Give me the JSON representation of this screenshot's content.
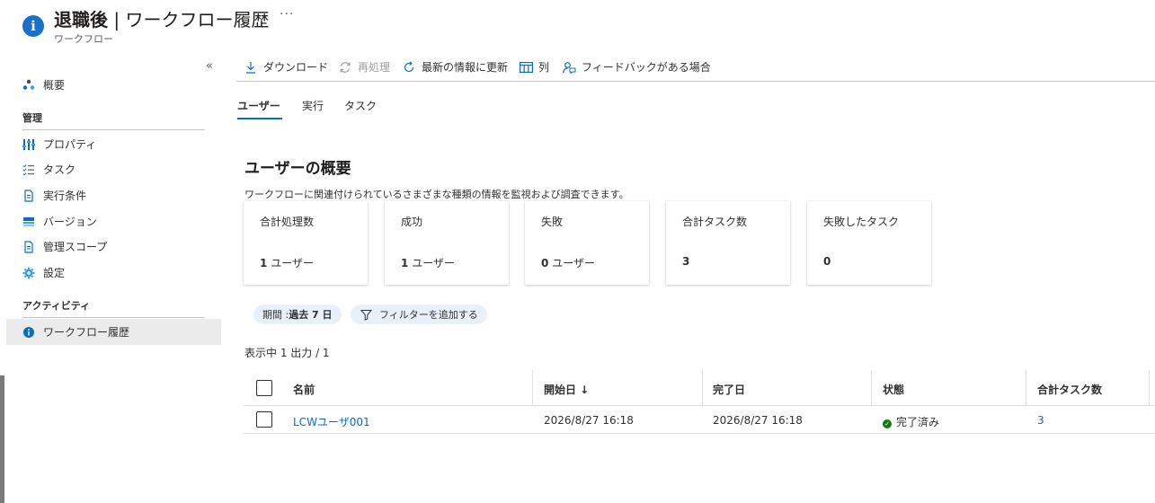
{
  "header": {
    "title_main": "退職後",
    "title_sep": " | ",
    "title_rest": "ワークフロー履歴",
    "more": "···",
    "subtitle": "ワークフロー",
    "icon": "info-icon"
  },
  "sidebar": {
    "collapse": "«",
    "overview": "概要",
    "section_manage": "管理",
    "manage_items": [
      {
        "label": "プロパティ",
        "icon": "properties-icon"
      },
      {
        "label": "タスク",
        "icon": "task-list-icon"
      },
      {
        "label": "実行条件",
        "icon": "document-icon"
      },
      {
        "label": "バージョン",
        "icon": "version-icon"
      },
      {
        "label": "管理スコープ",
        "icon": "document-icon"
      },
      {
        "label": "設定",
        "icon": "gear-icon"
      }
    ],
    "section_activity": "アクティビティ",
    "activity_items": [
      {
        "label": "ワークフロー履歴",
        "icon": "info-icon",
        "active": true
      }
    ]
  },
  "toolbar": {
    "download": "ダウンロード",
    "reprocess": "再処理",
    "refresh": "最新の情報に更新",
    "columns": "列",
    "feedback": "フィードバックがある場合"
  },
  "tabs": [
    "ユーザー",
    "実行",
    "タスク"
  ],
  "main": {
    "title": "ユーザーの概要",
    "description": "ワークフローに関連付けられているさまざまな種類の情報を監視および調査できます。"
  },
  "cards": [
    {
      "label": "合計処理数",
      "value": "1",
      "unit": "ユーザー"
    },
    {
      "label": "成功",
      "value": "1",
      "unit": "ユーザー"
    },
    {
      "label": "失敗",
      "value": "0",
      "unit": "ユーザー"
    },
    {
      "label": "合計タスク数",
      "value": "3",
      "unit": ""
    },
    {
      "label": "失敗したタスク",
      "value": "0",
      "unit": ""
    }
  ],
  "filters": {
    "period_label": "期間 : ",
    "period_value": "過去 7 日",
    "add_filter": "フィルターを追加する"
  },
  "count_line": "表示中 1 出力 / 1",
  "table": {
    "headers": [
      "名前",
      "開始日 ↓",
      "完了日",
      "状態",
      "合計タスク数"
    ],
    "rows": [
      {
        "name": "LCWユーザ001",
        "start": "2026/8/27 16:18",
        "end": "2026/8/27 16:18",
        "status": "完了済み",
        "tasks": "3"
      }
    ]
  },
  "colors": {
    "accent": "#0f6cbd",
    "success": "#107c10",
    "active_bg": "#ebebeb",
    "pill_bg": "#e8f1fb"
  }
}
